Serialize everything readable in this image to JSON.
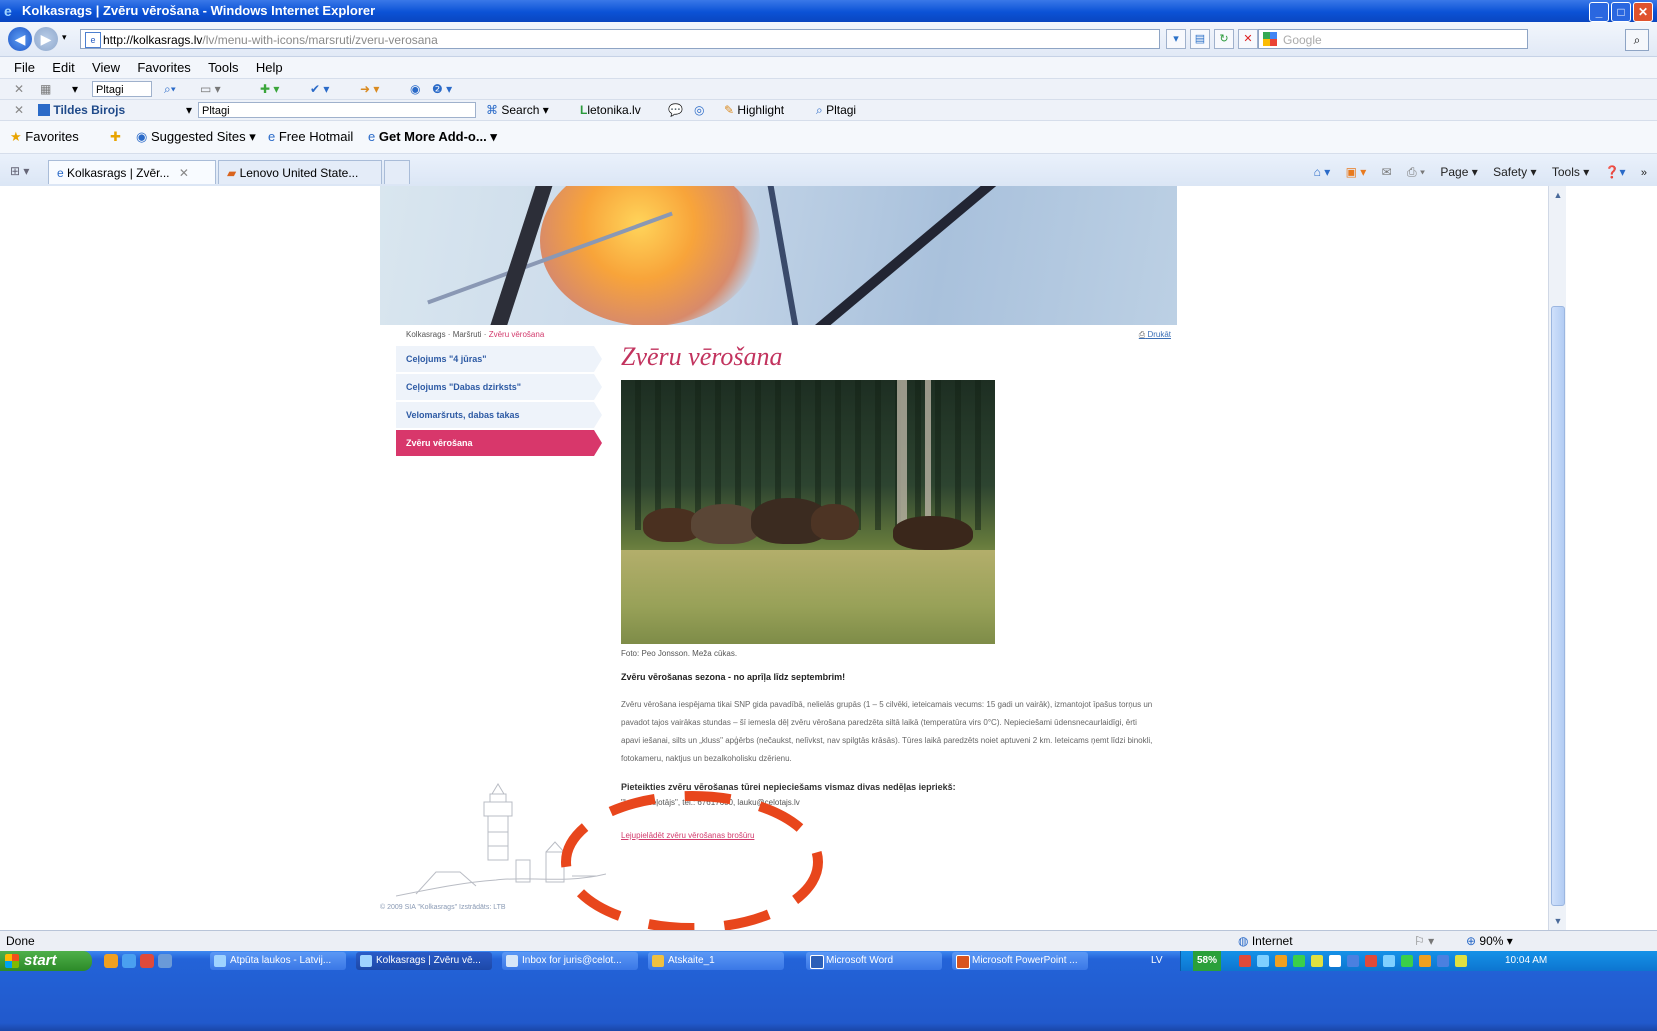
{
  "window": {
    "title": "Kolkasrags | Zvēru vērošana - Windows Internet Explorer"
  },
  "address": {
    "host": "http://kolkasrags.lv",
    "path": "/lv/menu-with-icons/marsruti/zveru-verosana"
  },
  "search": {
    "placeholder": "Google"
  },
  "menu": [
    "File",
    "Edit",
    "View",
    "Favorites",
    "Tools",
    "Help"
  ],
  "toolbar1": {
    "field": "Pltagi"
  },
  "toolbar2": {
    "brand": "Tildes Birojs",
    "field": "Pltagi",
    "search": "Search",
    "letonika": "letonika.lv",
    "highlight": "Highlight",
    "pltagi": "Pltagi"
  },
  "favorites": {
    "label": "Favorites",
    "items": [
      "Suggested Sites ▾",
      "Free Hotmail",
      "Get More Add-o... ▾"
    ]
  },
  "tabs": [
    "Kolkasrags | Zvēr...",
    "Lenovo United State..."
  ],
  "commandbar": [
    "Page ▾",
    "Safety ▾",
    "Tools ▾"
  ],
  "page": {
    "breadcrumb": {
      "home": "Kolkasrags",
      "sep": " · ",
      "routes": "Maršruti",
      "current": "Zvēru vērošana"
    },
    "print": "Drukāt",
    "nav": [
      "Ceļojums \"4 jūras\"",
      "Ceļojums \"Dabas dzirksts\"",
      "Velomaršruts, dabas takas",
      "Zvēru vērošana"
    ],
    "title": "Zvēru vērošana",
    "caption": "Foto: Peo Jonsson. Meža cūkas.",
    "season": "Zvēru vērošanas sezona - no aprīļa līdz septembrim!",
    "body": "Zvēru vērošana iespējama tikai SNP gida pavadībā, nelielās grupās (1 – 5 cilvēki, ieteicamais vecums: 15 gadi un vairāk), izmantojot īpašus torņus un pavadot tajos vairākas stundas – šī iemesla dēļ zvēru vērošana paredzēta siltā laikā (temperatūra virs 0°C). Nepieciešami ūdensnecaurlaidīgi, ērti apavi iešanai, silts un „kluss\" apģērbs (nečaukst, nelīvkst, nav spilgtās krāsās). Tūres laikā paredzēts noiet aptuveni 2 km. Ieteicams ņemt līdzi binokli, fotokameru, naktjus un bezalkoholisku dzērienu.",
    "apply": "Pieteikties zvēru vērošanas tūrei nepieciešams vismaz divas nedēļas iepriekš:",
    "contact": "\"Lauku ceļotājs\", tel.: 67617600, lauku@celotajs.lv",
    "download": "Lejupielādēt zvēru vērošanas brošūru",
    "copyright": "© 2009 SIA \"Kolkasrags\" Izstrādāts: LTB"
  },
  "status": {
    "left": "Done",
    "zone": "Internet",
    "zoom": "90%"
  },
  "taskbar": {
    "start": "start",
    "tasks": [
      "Atpūta laukos - Latvij...",
      "Kolkasrags | Zvēru vē...",
      "Inbox for juris@celot...",
      "Atskaite_1",
      "Microsoft Word",
      "Microsoft PowerPoint ..."
    ],
    "lang": "LV",
    "battery": "58%",
    "clock": "10:04 AM"
  },
  "colors": {
    "accent": "#d8376b",
    "title_pink": "#c2335e",
    "nav_blue": "#2d5aa4",
    "taskbar_blue": "#2159cc"
  }
}
